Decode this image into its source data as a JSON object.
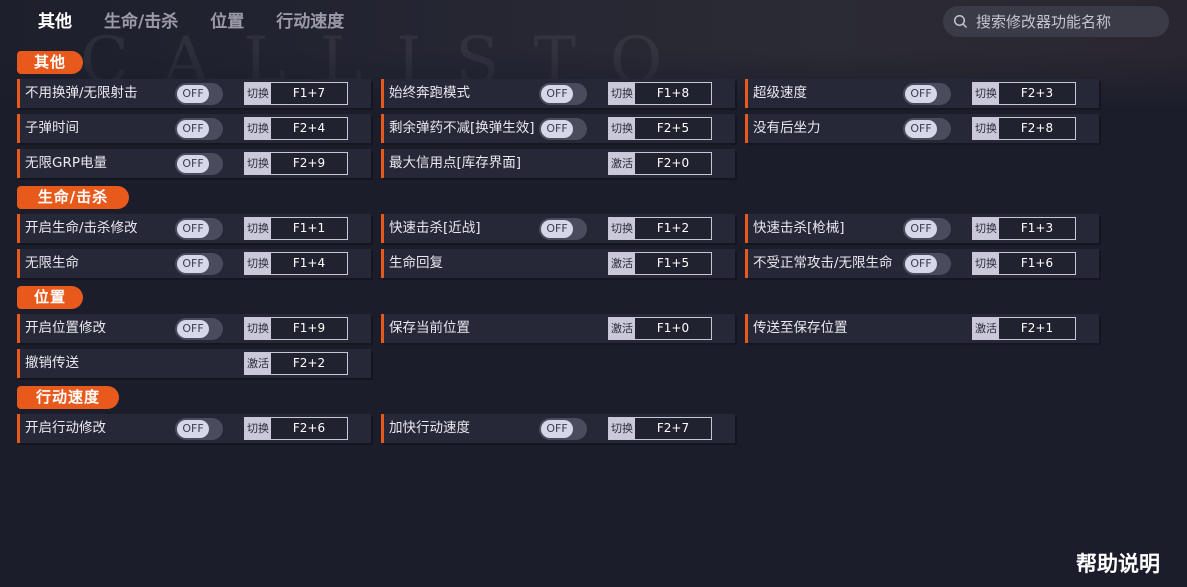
{
  "background_watermark": "CALLISTO",
  "nav": {
    "tabs": [
      {
        "label": "其他",
        "active": true
      },
      {
        "label": "生命/击杀",
        "active": false
      },
      {
        "label": "位置",
        "active": false
      },
      {
        "label": "行动速度",
        "active": false
      }
    ]
  },
  "search": {
    "placeholder": "搜索修改器功能名称",
    "icon": "search-icon"
  },
  "colors": {
    "accent": "#e8591c",
    "background": "#1b1d2b",
    "row": "#262838"
  },
  "sections": [
    {
      "title": "其他",
      "items": [
        {
          "label": "不用换弹/无限射击",
          "toggle": "OFF",
          "type": "切换",
          "key": "F1+7"
        },
        {
          "label": "始终奔跑模式",
          "toggle": "OFF",
          "type": "切换",
          "key": "F1+8"
        },
        {
          "label": "超级速度",
          "toggle": "OFF",
          "type": "切换",
          "key": "F2+3"
        },
        {
          "label": "子弹时间",
          "toggle": "OFF",
          "type": "切换",
          "key": "F2+4"
        },
        {
          "label": "剩余弹药不减[换弹生效]",
          "toggle": "OFF",
          "type": "切换",
          "key": "F2+5"
        },
        {
          "label": "没有后坐力",
          "toggle": "OFF",
          "type": "切换",
          "key": "F2+8"
        },
        {
          "label": "无限GRP电量",
          "toggle": "OFF",
          "type": "切换",
          "key": "F2+9"
        },
        {
          "label": "最大信用点[库存界面]",
          "toggle": null,
          "type": "激活",
          "key": "F2+0"
        }
      ]
    },
    {
      "title": "生命/击杀",
      "items": [
        {
          "label": "开启生命/击杀修改",
          "toggle": "OFF",
          "type": "切换",
          "key": "F1+1"
        },
        {
          "label": "快速击杀[近战]",
          "toggle": "OFF",
          "type": "切换",
          "key": "F1+2"
        },
        {
          "label": "快速击杀[枪械]",
          "toggle": "OFF",
          "type": "切换",
          "key": "F1+3"
        },
        {
          "label": "无限生命",
          "toggle": "OFF",
          "type": "切换",
          "key": "F1+4"
        },
        {
          "label": "生命回复",
          "toggle": null,
          "type": "激活",
          "key": "F1+5"
        },
        {
          "label": "不受正常攻击/无限生命",
          "toggle": "OFF",
          "type": "切换",
          "key": "F1+6"
        }
      ]
    },
    {
      "title": "位置",
      "items": [
        {
          "label": "开启位置修改",
          "toggle": "OFF",
          "type": "切换",
          "key": "F1+9"
        },
        {
          "label": "保存当前位置",
          "toggle": null,
          "type": "激活",
          "key": "F1+0"
        },
        {
          "label": "传送至保存位置",
          "toggle": null,
          "type": "激活",
          "key": "F2+1"
        },
        {
          "label": "撤销传送",
          "toggle": null,
          "type": "激活",
          "key": "F2+2"
        }
      ]
    },
    {
      "title": "行动速度",
      "items": [
        {
          "label": "开启行动修改",
          "toggle": "OFF",
          "type": "切换",
          "key": "F2+6"
        },
        {
          "label": "加快行动速度",
          "toggle": "OFF",
          "type": "切换",
          "key": "F2+7"
        }
      ]
    }
  ],
  "help_label": "帮助说明"
}
